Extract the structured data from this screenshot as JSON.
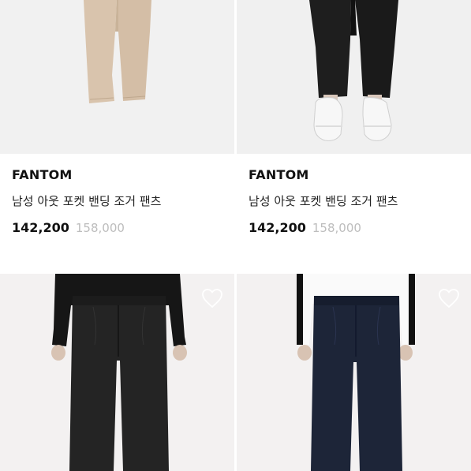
{
  "products": [
    {
      "brand": "FANTOM",
      "name": "남성 아웃 포켓 밴딩 조거 팬츠",
      "price": "142,200",
      "original_price": "158,000",
      "image": "beige-pants-photo"
    },
    {
      "brand": "FANTOM",
      "name": "남성 아웃 포켓 밴딩 조거 팬츠",
      "price": "142,200",
      "original_price": "158,000",
      "image": "black-pants-white-shoes-photo"
    },
    {
      "image": "black-dress-pants-photo",
      "wishlist_icon": "heart-outline-icon"
    },
    {
      "image": "navy-dress-pants-photo",
      "wishlist_icon": "heart-outline-icon"
    }
  ],
  "colors": {
    "price": "#111111",
    "original_price": "#bdbdbd",
    "image_bg": "#f1f1f1"
  }
}
